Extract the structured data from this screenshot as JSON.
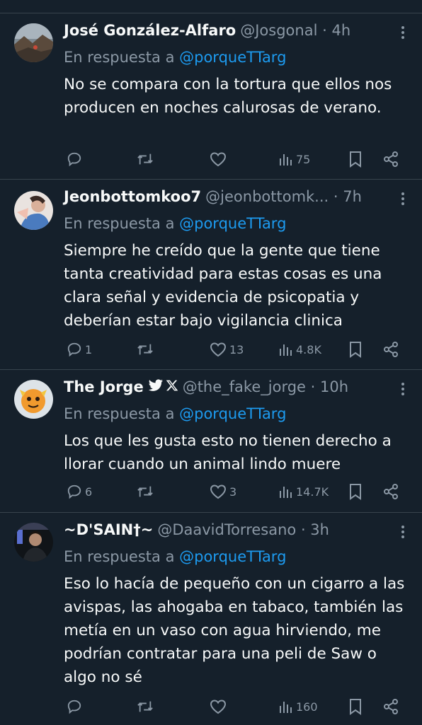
{
  "reply_prefix": "En respuesta a",
  "tweets": [
    {
      "name": "José González-Alfaro",
      "handle": "@Josgonal",
      "time": "· 4h",
      "reply_to": "@porqueTTarg",
      "text": "No se compara con la tortura que ellos nos producen en noches calurosas de verano.",
      "replies": "",
      "retweets": "",
      "likes": "",
      "views": "75"
    },
    {
      "name": "Jeonbottomkoo7",
      "handle": "@jeonbottomk...",
      "time": "· 7h",
      "reply_to": "@porqueTTarg",
      "text": "Siempre he creído que la gente que tiene tanta creatividad para estas cosas es una clara señal y evidencia de psicopatia y deberían estar bajo vigilancia clinica",
      "replies": "1",
      "retweets": "",
      "likes": "13",
      "views": "4.8K"
    },
    {
      "name": "The Jorge",
      "name_badges": "🐦𝕏",
      "handle": "@the_fake_jorge",
      "time": "· 10h",
      "reply_to": "@porqueTTarg",
      "text": "Los que les gusta esto no tienen derecho a llorar cuando un animal lindo muere",
      "replies": "6",
      "retweets": "",
      "likes": "3",
      "views": "14.7K"
    },
    {
      "name": "~D'SAIN†~",
      "handle": "@DaavidTorresano",
      "time": "· 3h",
      "reply_to": "@porqueTTarg",
      "text": "Eso lo hacía de pequeño con un cigarro a las avispas, las ahogaba en tabaco, también las metía en un vaso con agua hirviendo, me podrían contratar para una peli de Saw o algo no sé",
      "replies": "",
      "retweets": "",
      "likes": "",
      "views": "160"
    }
  ],
  "icons": {
    "reply": "reply-icon",
    "retweet": "retweet-icon",
    "like": "heart-icon",
    "views": "views-icon",
    "bookmark": "bookmark-icon",
    "share": "share-icon",
    "more": "more-icon"
  },
  "colors": {
    "background": "#15202b",
    "text": "#f7f9f9",
    "secondary": "#8b98a5",
    "accent": "#1d9bf0",
    "divider": "#38444d"
  }
}
